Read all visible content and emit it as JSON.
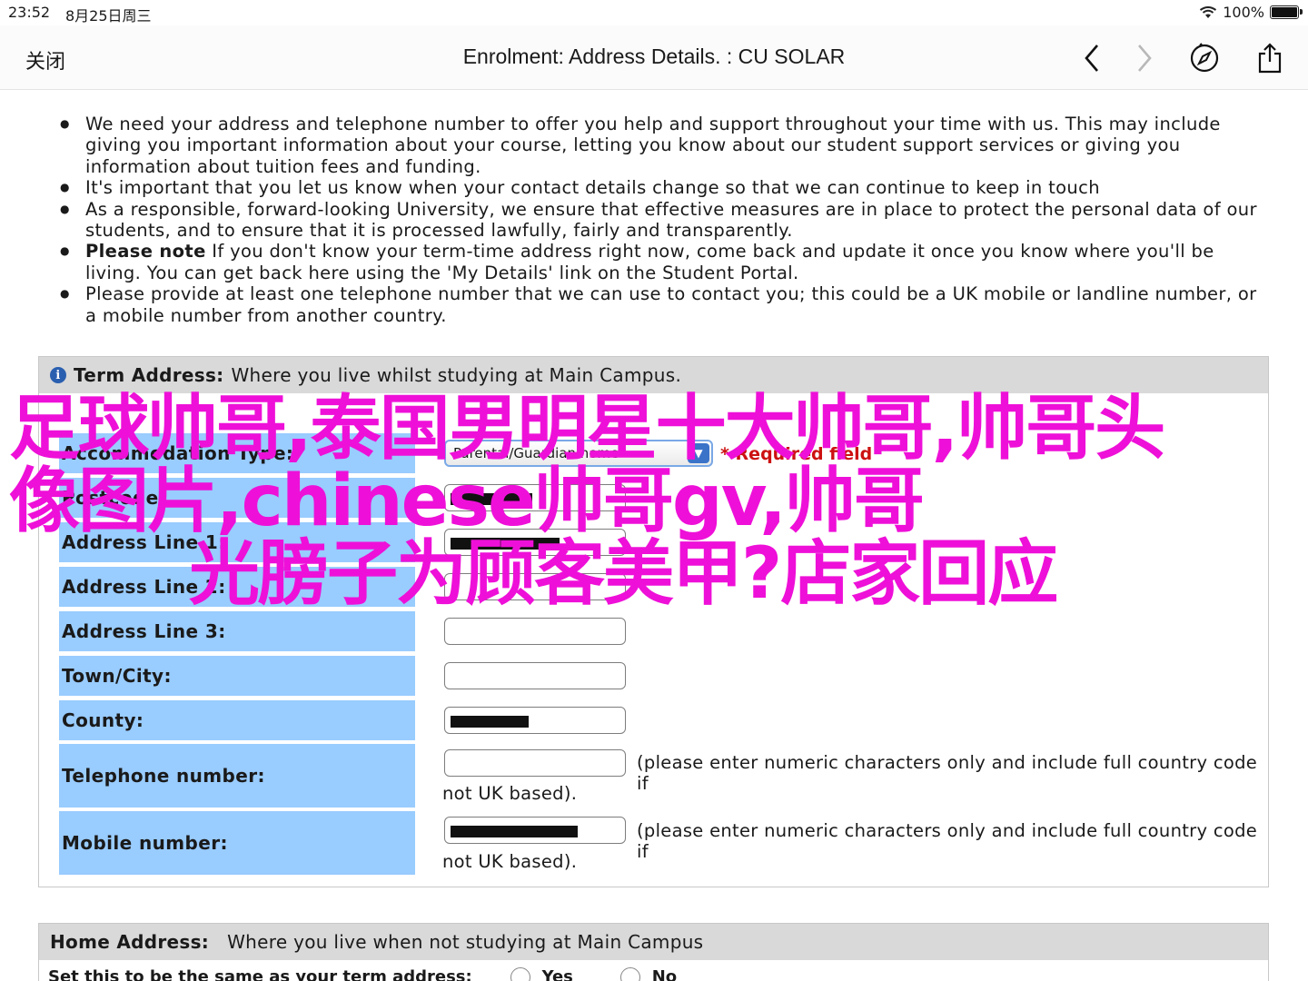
{
  "status_bar": {
    "time": "23:52",
    "date": "8月25日周三",
    "battery": "100%"
  },
  "nav": {
    "close_label": "关闭",
    "title": "Enrolment: Address Details. : CU SOLAR",
    "icons": [
      "back-icon",
      "forward-icon",
      "compass-icon",
      "share-icon"
    ]
  },
  "notes": [
    {
      "bold": "",
      "text": "We need your address and telephone number to offer you help and support throughout your time with us. This may include giving you important information about your course, letting you know about our student support services or giving you information about tuition fees and funding."
    },
    {
      "bold": "",
      "text": "It's important that you let us know when your contact details change so that we can continue to keep in touch"
    },
    {
      "bold": "",
      "text": "As a responsible, forward-looking University, we ensure that effective measures are in place to protect the personal data of our students, and to ensure that it is processed lawfully, fairly and transparently."
    },
    {
      "bold": "Please note",
      "text": " If you don't know your term-time address right now, come back and update it once you know where you'll be living. You can get back here using the 'My Details' link on the Student Portal."
    },
    {
      "bold": "",
      "text": "Please provide at least one telephone number that we can use to contact you; this could be a UK mobile or landline number, or a mobile number from another country."
    }
  ],
  "term_address": {
    "heading": "Term Address:",
    "subheading": "Where you live whilst studying at Main Campus.",
    "accommodation_label": "Accommodation Type:",
    "accommodation_value": "Parental/Guardian home",
    "required_label": "* Required field",
    "postcode_label": "Postcode:",
    "address1_label": "Address Line 1:",
    "address2_label": "Address Line 2:",
    "address3_label": "Address Line 3:",
    "town_label": "Town/City:",
    "county_label": "County:",
    "telephone_label": "Telephone number:",
    "mobile_label": "Mobile number:",
    "numeric_hint_line1": "(please enter numeric characters only and include full country code if",
    "numeric_hint_line2": "not UK based)."
  },
  "home_address": {
    "heading": "Home Address:",
    "subheading": "Where you live when not studying at Main Campus",
    "same_as_term_label": "Set this to be the same as your term address:",
    "yes_label": "Yes",
    "no_label": "No"
  },
  "overlay": {
    "line1": "足球帅哥,泰国男明星十大帅哥,帅哥头",
    "line2": "像图片,chinese帅哥gv,帅哥",
    "line3": "光膀子为顾客美甲?店家回应",
    "color": "#ee10d8"
  }
}
